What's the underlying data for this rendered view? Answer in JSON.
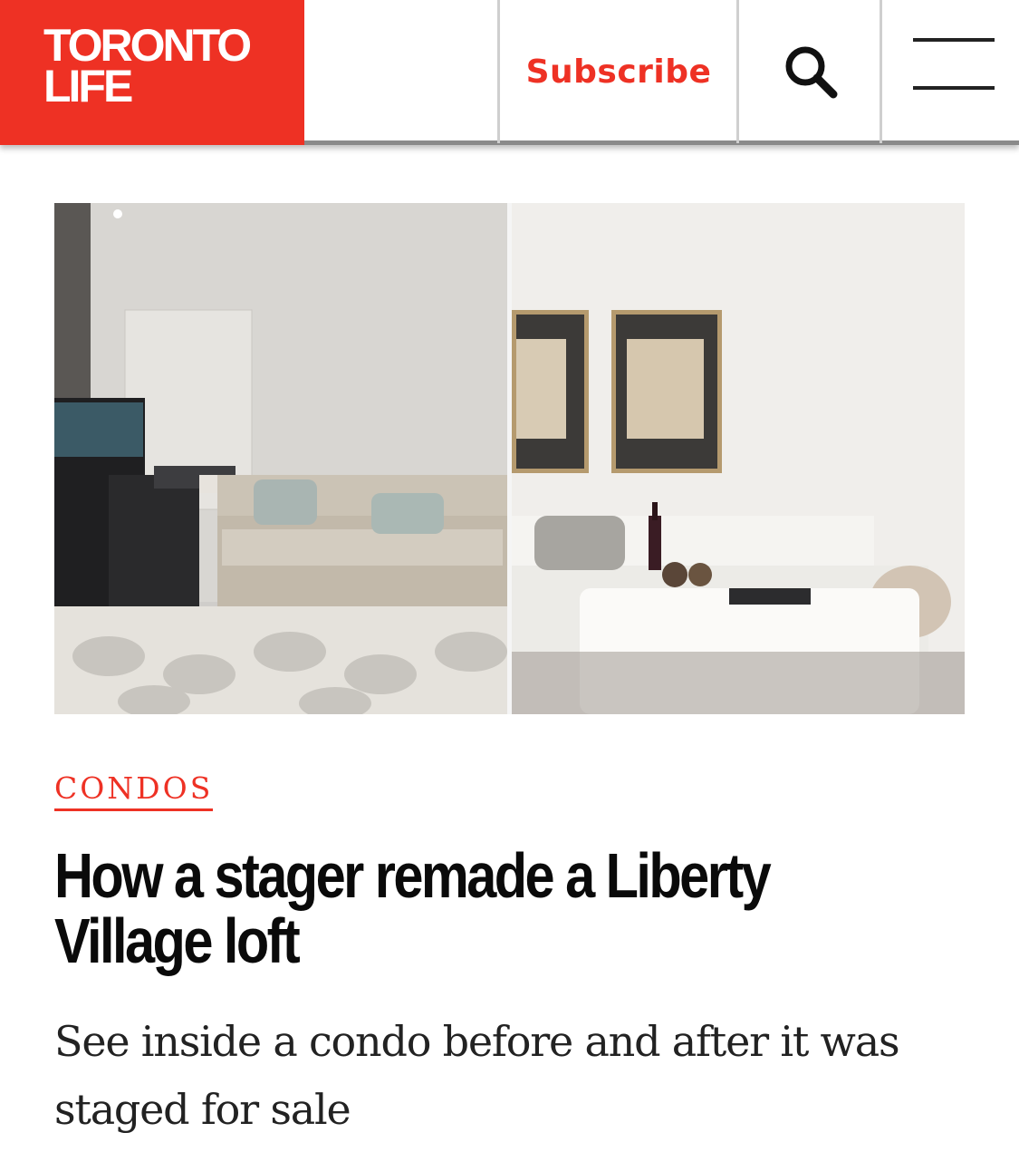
{
  "header": {
    "logo_line1": "TORONTO",
    "logo_line2": "LIFE",
    "subscribe_label": "Subscribe",
    "search_icon": "search-icon",
    "menu_icon": "hamburger-menu-icon"
  },
  "colors": {
    "brand_red": "#ee3124",
    "text": "#0a0a0a"
  },
  "article": {
    "category": "CONDOS",
    "headline": "How a stager remade a Liberty Village loft",
    "dek": "See inside a condo before and after it was staged for sale",
    "hero_alt": "Before and after photos of a condo living room"
  }
}
